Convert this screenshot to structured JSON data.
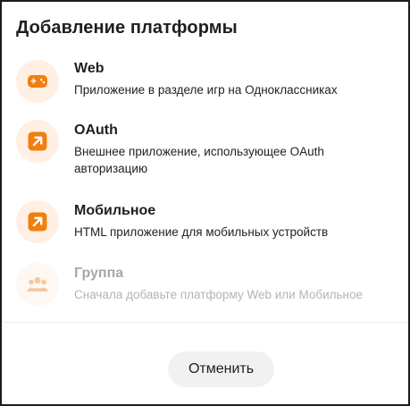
{
  "dialog": {
    "title": "Добавление платформы",
    "options": [
      {
        "title": "Web",
        "description": "Приложение в разделе игр на Одноклассниках",
        "icon": "gamepad-icon",
        "enabled": true
      },
      {
        "title": "OAuth",
        "description": "Внешнее приложение, использующее OAuth авторизацию",
        "icon": "external-arrow-icon",
        "enabled": true
      },
      {
        "title": "Мобильное",
        "description": "HTML приложение для мобильных устройств",
        "icon": "external-arrow-icon",
        "enabled": true
      },
      {
        "title": "Группа",
        "description": "Сначала добавьте платформу Web или Мобильное",
        "icon": "group-icon",
        "enabled": false
      }
    ],
    "cancel_label": "Отменить"
  },
  "colors": {
    "accent": "#f07f0f",
    "icon_bg": "#fff0e3",
    "disabled_icon": "#f5c8a4",
    "disabled_text": "#a8a8a8"
  }
}
